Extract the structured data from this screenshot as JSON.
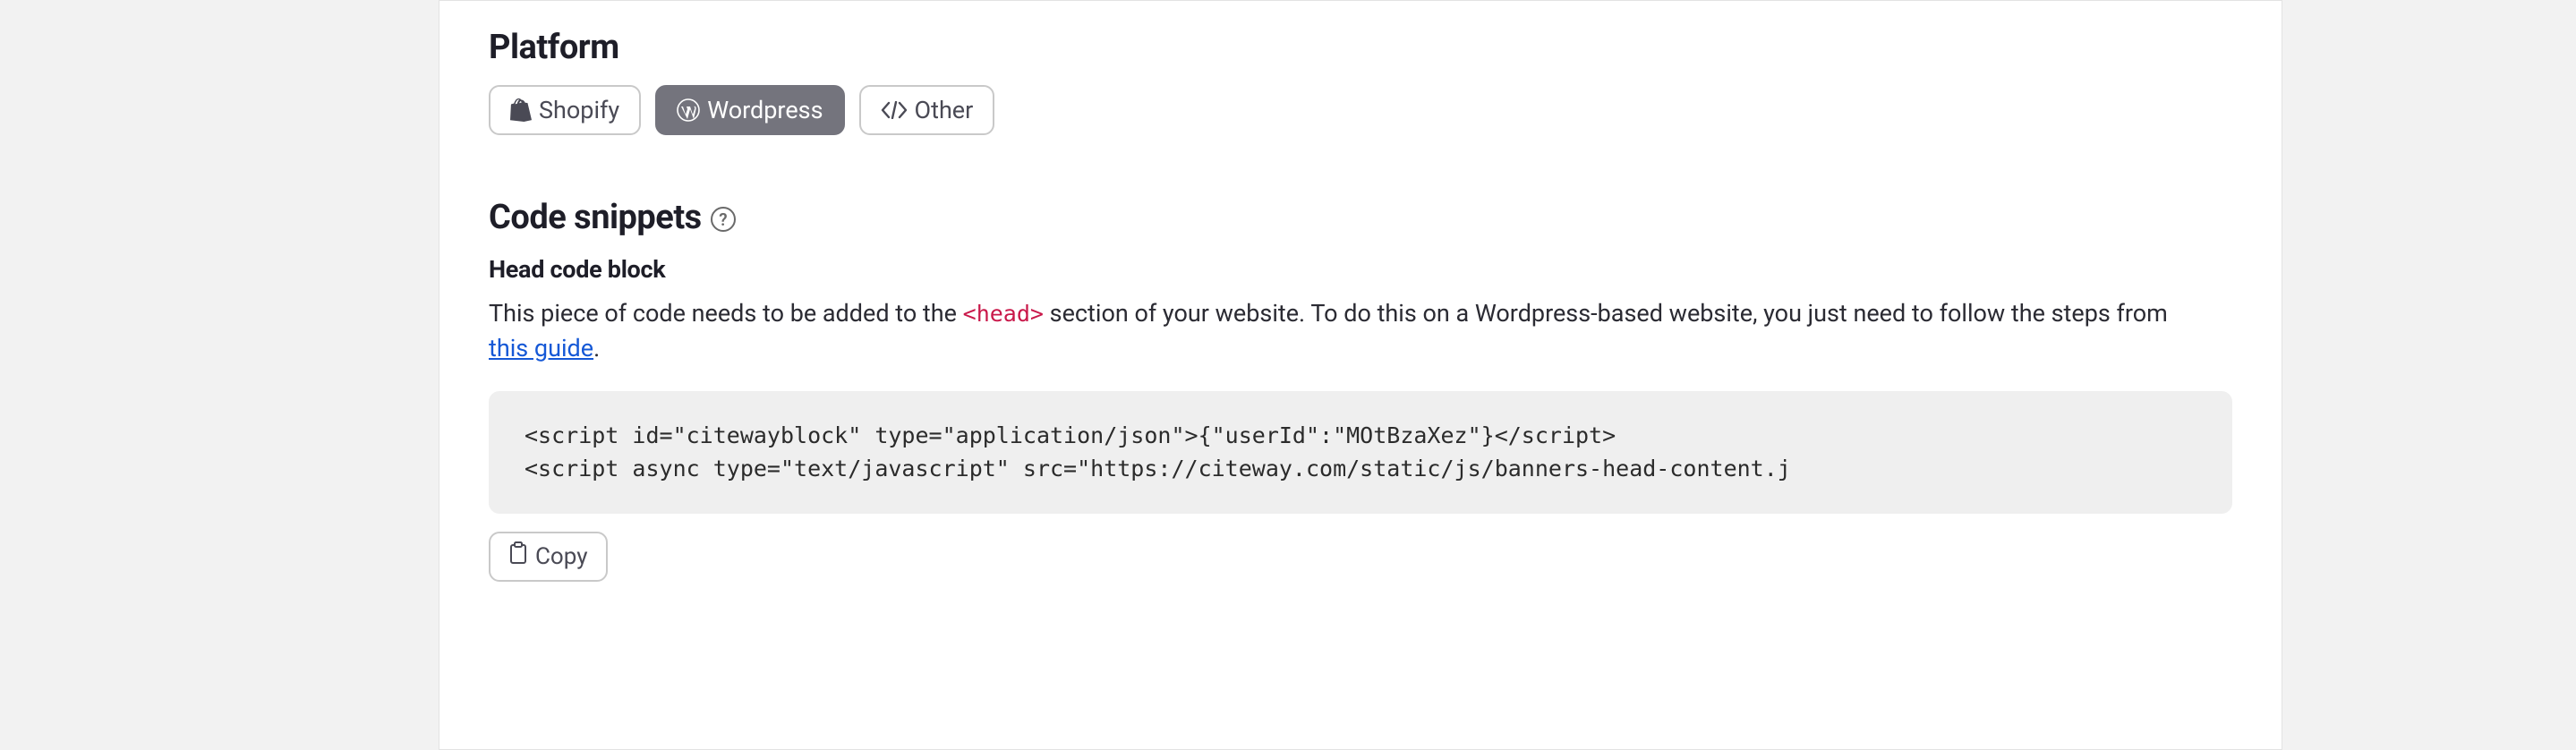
{
  "platform": {
    "title": "Platform",
    "options": [
      {
        "label": "Shopify",
        "icon": "shopify-icon",
        "active": false
      },
      {
        "label": "Wordpress",
        "icon": "wordpress-icon",
        "active": true
      },
      {
        "label": "Other",
        "icon": "code-icon",
        "active": false
      }
    ]
  },
  "snippets": {
    "title": "Code snippets",
    "head_block": {
      "subtitle": "Head code block",
      "desc_prefix": "This piece of code needs to be added to the ",
      "desc_code": "<head>",
      "desc_middle": " section of your website. To do this on a Wordpress-based website, you just need to follow the steps from ",
      "desc_link_text": "this guide",
      "desc_suffix": ".",
      "code_line1": "<script id=\"citewayblock\" type=\"application/json\">{\"userId\":\"MOtBzaXez\"}</script>",
      "code_line2": "<script async type=\"text/javascript\" src=\"https://citeway.com/static/js/banners-head-content.j",
      "copy_label": "Copy"
    }
  }
}
